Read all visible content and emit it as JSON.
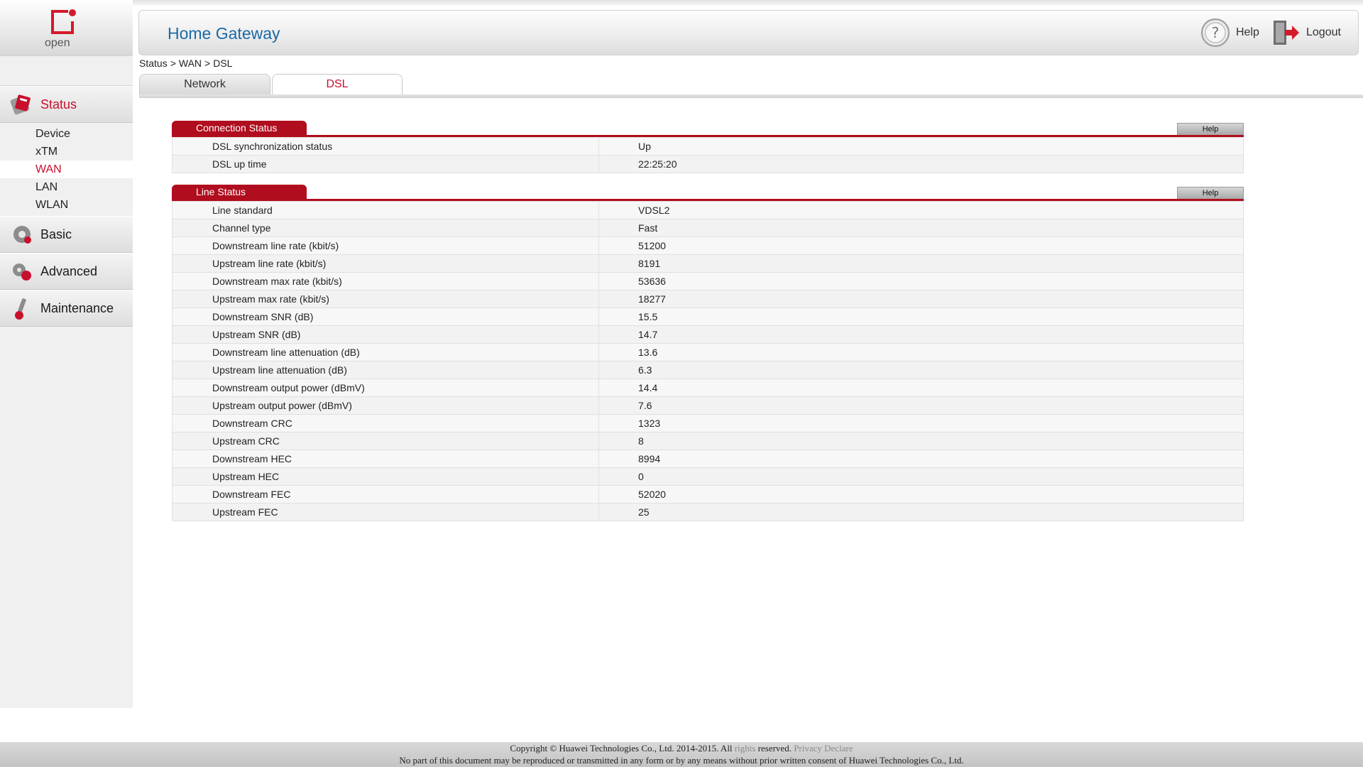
{
  "brand": {
    "logo_text": "open",
    "app_title": "Home Gateway"
  },
  "header": {
    "help_label": "Help",
    "logout_label": "Logout"
  },
  "breadcrumb": [
    "Status",
    ">",
    "WAN",
    ">",
    "DSL"
  ],
  "tabs": [
    {
      "label": "Network",
      "active": false
    },
    {
      "label": "DSL",
      "active": true
    }
  ],
  "sidebar": {
    "sections": [
      {
        "label": "Status",
        "icon": "status-icon",
        "active": true,
        "items": [
          {
            "label": "Device"
          },
          {
            "label": "xTM"
          },
          {
            "label": "WAN",
            "active": true
          },
          {
            "label": "LAN"
          },
          {
            "label": "WLAN"
          }
        ]
      },
      {
        "label": "Basic",
        "icon": "basic-gear-icon"
      },
      {
        "label": "Advanced",
        "icon": "advanced-icon"
      },
      {
        "label": "Maintenance",
        "icon": "maintenance-icon"
      }
    ]
  },
  "connection_status": {
    "title": "Connection Status",
    "help": "Help",
    "rows": [
      {
        "k": "DSL synchronization status",
        "v": "Up"
      },
      {
        "k": "DSL up time",
        "v": "22:25:20"
      }
    ]
  },
  "line_status": {
    "title": "Line Status",
    "help": "Help",
    "rows": [
      {
        "k": "Line standard",
        "v": "VDSL2"
      },
      {
        "k": "Channel type",
        "v": "Fast"
      },
      {
        "k": "Downstream line rate (kbit/s)",
        "v": "51200"
      },
      {
        "k": "Upstream line rate (kbit/s)",
        "v": "8191"
      },
      {
        "k": "Downstream max rate (kbit/s)",
        "v": "53636"
      },
      {
        "k": "Upstream max rate (kbit/s)",
        "v": "18277"
      },
      {
        "k": "Downstream SNR (dB)",
        "v": "15.5"
      },
      {
        "k": "Upstream SNR (dB)",
        "v": "14.7"
      },
      {
        "k": "Downstream line attenuation (dB)",
        "v": "13.6"
      },
      {
        "k": "Upstream line attenuation (dB)",
        "v": "6.3"
      },
      {
        "k": "Downstream output power (dBmV)",
        "v": "14.4"
      },
      {
        "k": "Upstream output power (dBmV)",
        "v": "7.6"
      },
      {
        "k": "Downstream CRC",
        "v": "1323"
      },
      {
        "k": "Upstream CRC",
        "v": "8"
      },
      {
        "k": "Downstream HEC",
        "v": "8994"
      },
      {
        "k": "Upstream HEC",
        "v": "0"
      },
      {
        "k": "Downstream FEC",
        "v": "52020"
      },
      {
        "k": "Upstream FEC",
        "v": "25"
      }
    ]
  },
  "footer": {
    "copyright_a": "Copyright © Huawei Technologies Co., Ltd. 2014-2015. All",
    "copyright_rights": "rights",
    "copyright_b": "reserved.",
    "privacy_link": "Privacy Declare",
    "notice": "No part of this document may be reproduced or transmitted in any form or by any means without prior written consent of Huawei Technologies Co., Ltd."
  },
  "colors": {
    "accent_red": "#b00d1e",
    "title_blue": "#1b6aa5",
    "active_text": "#c8102e"
  }
}
